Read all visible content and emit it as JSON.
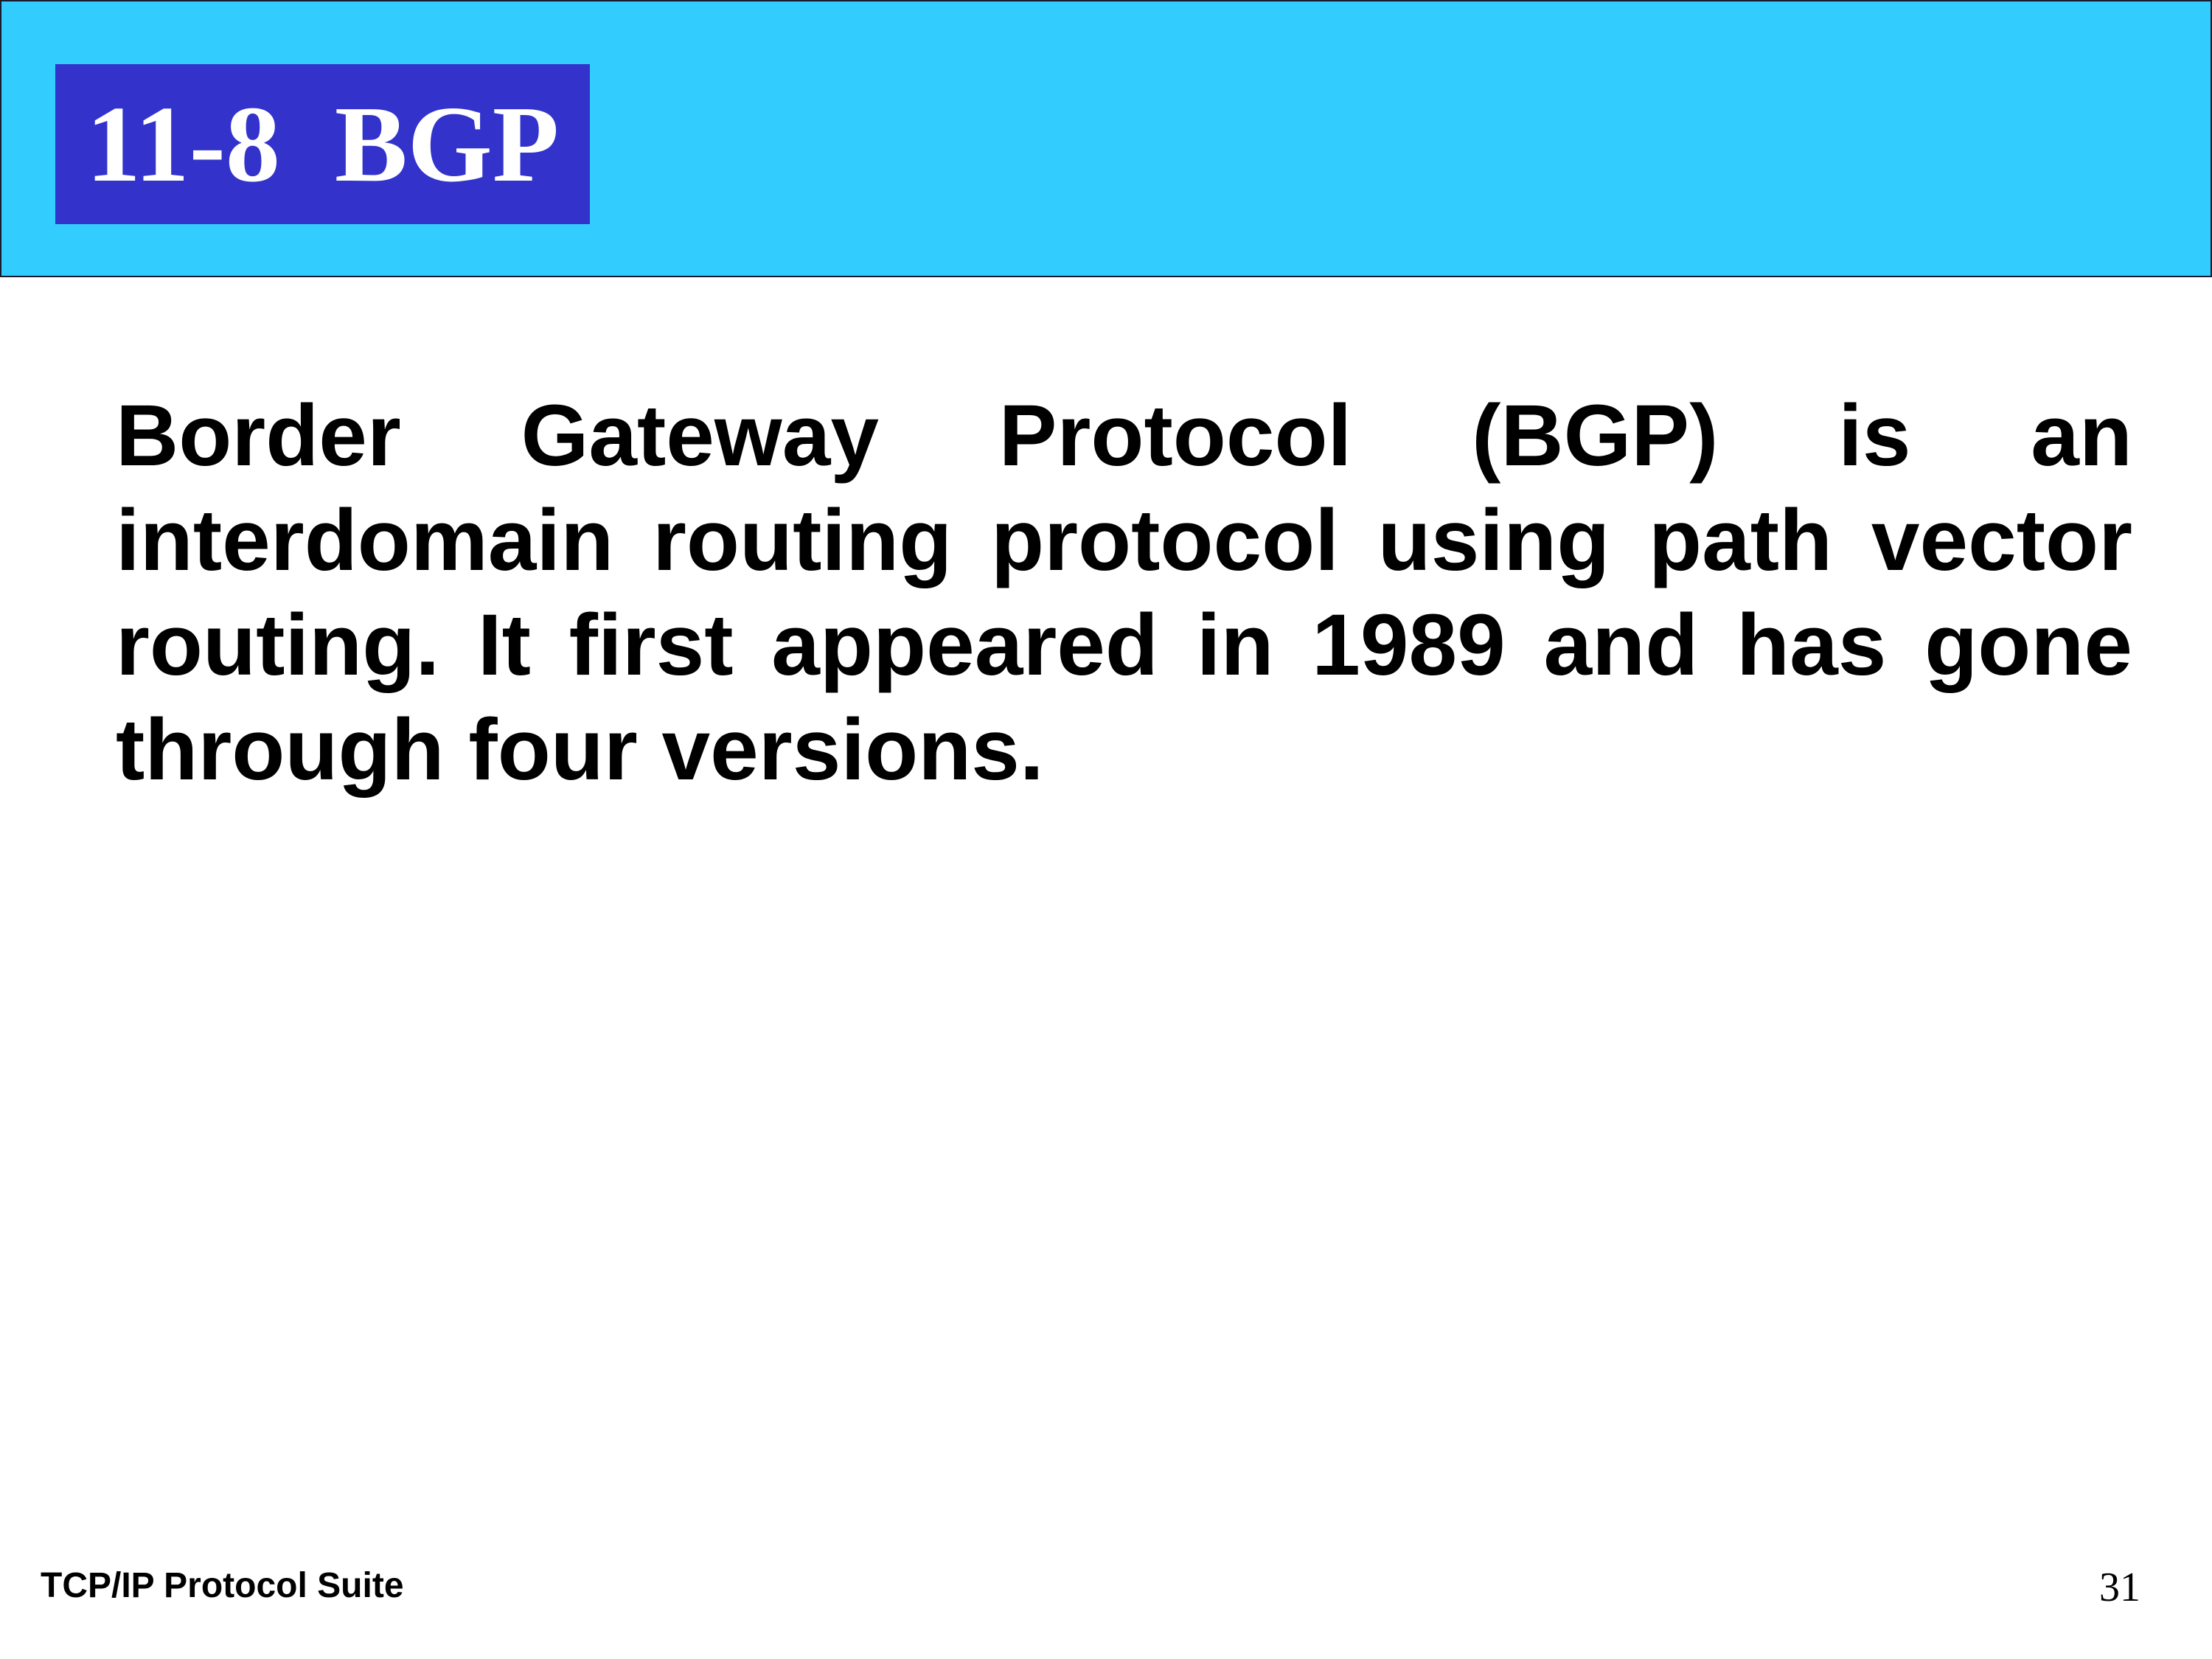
{
  "slide": {
    "title": "11-8  BGP",
    "body": "Border Gateway Protocol (BGP) is an interdomain routing protocol using path vector routing. It first appeared in 1989 and has gone through four versions.",
    "footer_left": "TCP/IP Protocol Suite",
    "page_number": "31"
  },
  "colors": {
    "header_band": "#33ccff",
    "title_box": "#3333cc",
    "title_text": "#ffffff",
    "body_text": "#000000"
  }
}
